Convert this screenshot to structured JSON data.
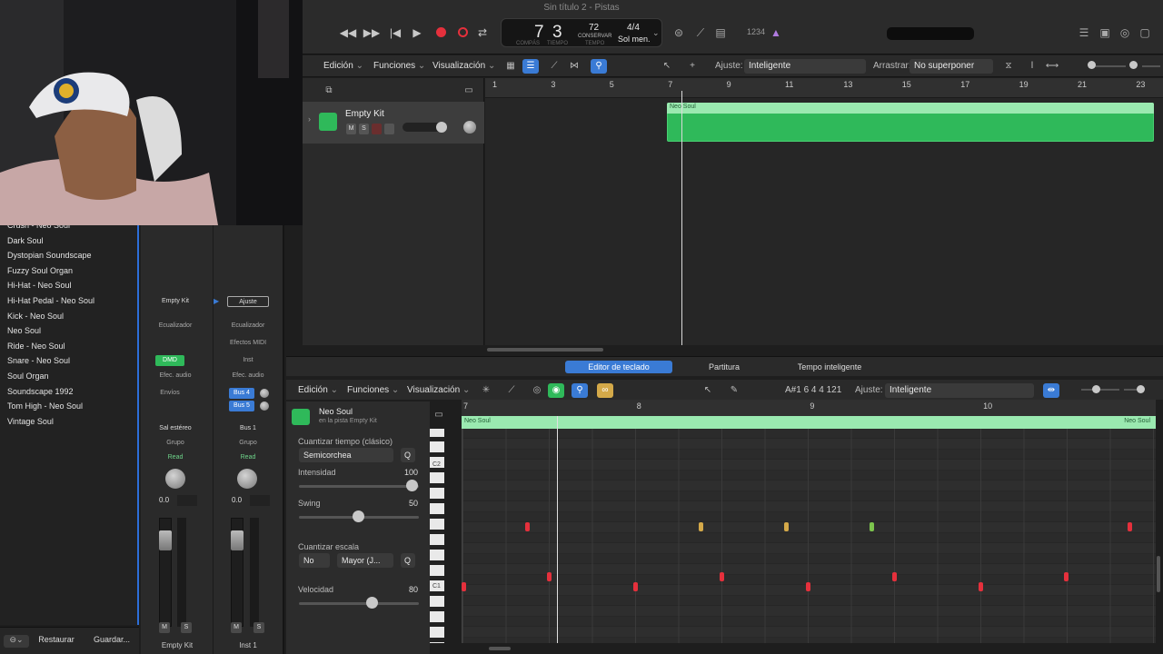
{
  "window_title": "Sin título 2 - Pistas",
  "transport": {
    "bar": "7",
    "beat": "3",
    "bar_label": "COMPÁS",
    "beat_label": "TIEMPO",
    "tempo": "72",
    "tempo_mode": "CONSERVAR",
    "tempo_label": "TEMPO",
    "signature": "4/4",
    "key": "Sol men.",
    "count_in": "1234"
  },
  "tracks_toolbar": {
    "edit": "Edición",
    "functions": "Funciones",
    "view": "Visualización",
    "snap_label": "Ajuste:",
    "snap_value": "Inteligente",
    "drag_label": "Arrastrar:",
    "drag_value": "No superponer"
  },
  "timeline": {
    "bars": [
      "1",
      "3",
      "5",
      "7",
      "9",
      "11",
      "13",
      "15",
      "17",
      "19",
      "21",
      "23"
    ]
  },
  "track": {
    "name": "Empty Kit",
    "mute": "M",
    "solo": "S",
    "region_name": "Neo Soul"
  },
  "library": {
    "items": [
      "Crush - Neo Soul",
      "Dark Soul",
      "Dystopian Soundscape",
      "Fuzzy Soul Organ",
      "Hi-Hat - Neo Soul",
      "Hi-Hat Pedal - Neo Soul",
      "Kick - Neo Soul",
      "Neo Soul",
      "Ride - Neo Soul",
      "Snare - Neo Soul",
      "Soul Organ",
      "Soundscape 1992",
      "Tom High - Neo Soul",
      "Vintage Soul"
    ],
    "restore": "Restaurar",
    "save": "Guardar..."
  },
  "mixer": {
    "strip1": {
      "name": "Empty Kit",
      "eq": "Ecualizador",
      "plugin": "DMD",
      "fx": "Efec. audio",
      "sends": "Envíos",
      "output": "Sal estéreo",
      "group": "Grupo",
      "automation": "Read",
      "volume": "0.0",
      "mute": "M",
      "solo": "S"
    },
    "strip2": {
      "name": "Inst 1",
      "setting": "Ajuste",
      "eq": "Ecualizador",
      "midi_fx": "Efectos MIDI",
      "inst": "Inst",
      "fx": "Efec. audio",
      "bus4": "Bus 4",
      "bus5": "Bus 5",
      "output": "Bus 1",
      "group": "Grupo",
      "automation": "Read",
      "volume": "0.0",
      "mute": "M",
      "solo": "S"
    }
  },
  "editor": {
    "tabs": [
      "Editor de teclado",
      "Partitura",
      "Tempo inteligente"
    ],
    "edit": "Edición",
    "functions": "Funciones",
    "view": "Visualización",
    "position": "A#1  6 4 4 121",
    "snap_label": "Ajuste:",
    "snap_value": "Inteligente",
    "region_name": "Neo Soul",
    "region_sub": "en la pista Empty Kit",
    "quantize_label": "Cuantizar tiempo (clásico)",
    "quantize_value": "Semicorchea",
    "q_button": "Q",
    "intensity_label": "Intensidad",
    "intensity_value": "100",
    "swing_label": "Swing",
    "swing_value": "50",
    "scale_label": "Cuantizar escala",
    "scale_mode": "No",
    "scale_value": "Mayor (J...",
    "scale_q": "Q",
    "velocity_label": "Velocidad",
    "velocity_value": "80",
    "ruler": [
      "7",
      "8",
      "9",
      "10"
    ],
    "key_labels": [
      "C2",
      "C1"
    ],
    "region_bar_left": "Neo Soul",
    "region_bar_right": "Neo Soul"
  },
  "colors": {
    "accent": "#3a7bd5",
    "region": "#2fb95a",
    "note_red": "#e5303c",
    "note_yellow": "#d4a949",
    "note_green": "#7cc44d"
  }
}
